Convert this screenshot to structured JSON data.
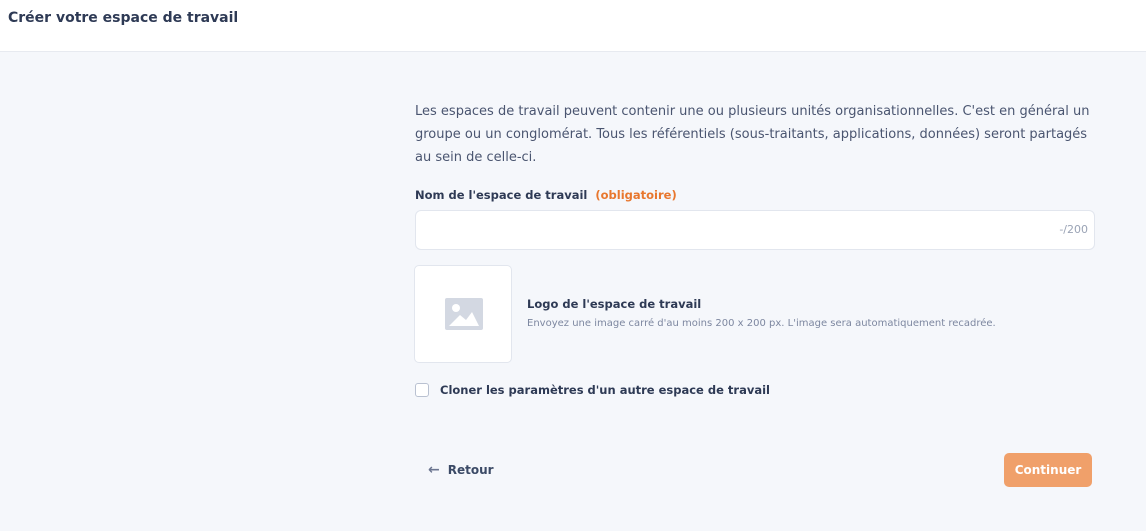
{
  "header": {
    "title": "Créer votre espace de travail"
  },
  "intro": {
    "text": "Les espaces de travail peuvent contenir une ou plusieurs unités organisationnelles. C'est en général un groupe ou un conglomérat. Tous les référentiels (sous-traitants, applications, données) seront partagés au sein de celle-ci."
  },
  "name_field": {
    "label": "Nom de l'espace de travail",
    "required": "(obligatoire)",
    "value": "",
    "placeholder": "",
    "counter": "-/200"
  },
  "logo": {
    "icon": "image-placeholder-icon",
    "title": "Logo de l'espace de travail",
    "hint": "Envoyez une image carré d'au moins 200 x 200 px. L'image sera automatiquement recadrée."
  },
  "clone": {
    "label": "Cloner les paramètres d'un autre espace de travail",
    "checked": false
  },
  "footer": {
    "back_icon": "arrow-left-icon",
    "back_label": "Retour",
    "continue_label": "Continuer"
  },
  "colors": {
    "accent": "#f0a06a",
    "required": "#e8772e",
    "background": "#f5f7fb"
  }
}
